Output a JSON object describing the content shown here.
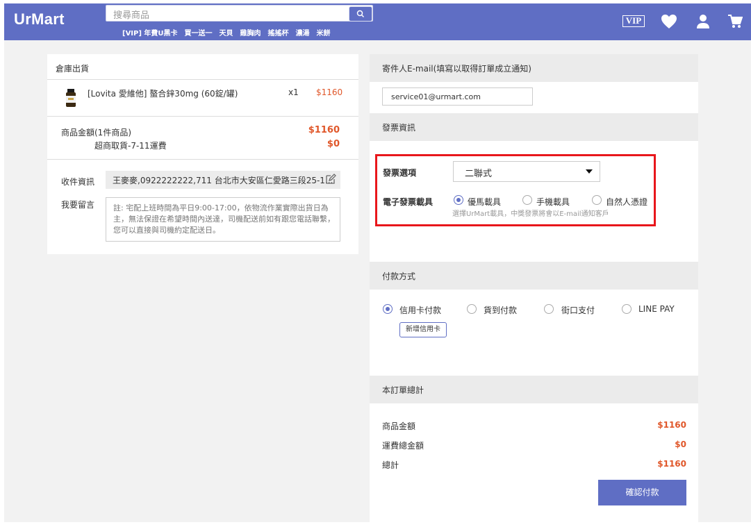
{
  "header": {
    "logo": "UrMart",
    "search_placeholder": "搜尋商品",
    "hot_keywords": [
      "[VIP] 年費U黑卡",
      "買一送一",
      "天貝",
      "雞胸肉",
      "搖搖杯",
      "濃湯",
      "米餅"
    ],
    "vip_label": "VIP",
    "icons": [
      "search-icon",
      "heart-icon",
      "user-icon",
      "cart-icon"
    ]
  },
  "order": {
    "warehouse_title": "倉庫出貨",
    "product": {
      "name": "[Lovita 愛維他] 螯合鋅30mg (60錠/罐)",
      "qty": "x1",
      "price": "$1160"
    },
    "subtotal_label": "商品金額(1件商品)",
    "subtotal_value": "$1160",
    "shipping_label": "超商取貨-7-11運費",
    "shipping_value": "$0",
    "recipient_label": "收件資訊",
    "recipient_value": "王麥麥,0922222222,711 台北市大安區仁愛路三段25-1...",
    "message_label": "我要留言",
    "message_text": "註: 宅配上班時間為平日9:00-17:00，依物流作業實際出貨日為主，無法保證在希望時間內送達，司機配送前如有跟您電話聯繫，您可以直接與司機約定配送日。"
  },
  "sender": {
    "title": "寄件人E-mail(填寫以取得訂單成立通知)",
    "email": "service01@urmart.com"
  },
  "invoice": {
    "title": "發票資訊",
    "option_label": "發票選項",
    "option_selected": "二聯式",
    "carrier_label": "電子發票載具",
    "carriers": [
      {
        "label": "優馬載具",
        "checked": true
      },
      {
        "label": "手機載具",
        "checked": false
      },
      {
        "label": "自然人憑證",
        "checked": false
      }
    ],
    "hint": "選擇UrMart載具，中獎發票將會以E-mail通知客戶"
  },
  "payment": {
    "title": "付款方式",
    "methods": [
      {
        "label": "信用卡付款",
        "checked": true
      },
      {
        "label": "貨到付款",
        "checked": false
      },
      {
        "label": "街口支付",
        "checked": false
      },
      {
        "label": "LINE PAY",
        "checked": false
      }
    ],
    "add_card_label": "新增信用卡"
  },
  "totals": {
    "title": "本訂單總計",
    "rows": [
      {
        "label": "商品金額",
        "value": "$1160"
      },
      {
        "label": "運費總金額",
        "value": "$0"
      },
      {
        "label": "總計",
        "value": "$1160"
      }
    ],
    "confirm_label": "確認付款"
  },
  "colors": {
    "brand": "#5f6ec4",
    "price": "#e0572a",
    "highlight": "#e8161b"
  }
}
